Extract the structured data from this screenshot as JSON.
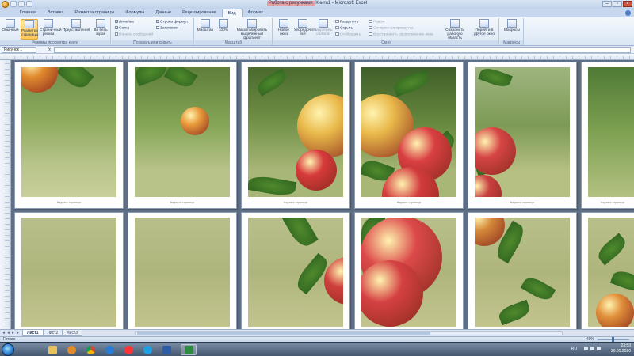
{
  "window": {
    "title_doc": "Книга1",
    "title_sep": " - ",
    "title_app": "Microsoft Excel",
    "title_extra": "Работа с рисунками"
  },
  "ribbon_tabs": [
    {
      "label": "Главная",
      "active": false
    },
    {
      "label": "Вставка",
      "active": false
    },
    {
      "label": "Разметка страницы",
      "active": false
    },
    {
      "label": "Формулы",
      "active": false
    },
    {
      "label": "Данные",
      "active": false
    },
    {
      "label": "Рецензирование",
      "active": false
    },
    {
      "label": "Вид",
      "active": true
    },
    {
      "label": "Формат",
      "active": false
    }
  ],
  "ribbon": {
    "group_views": {
      "label": "Режимы просмотра книги",
      "normal": "Обычный",
      "page_layout": "Разметка страницы",
      "page_mode": "Страничный режим",
      "custom_views": "Представления",
      "full_screen": "Во весь экран"
    },
    "group_show": {
      "label": "Показать или скрыть",
      "ruler": "Линейка",
      "grid": "Сетка",
      "messages": "Панель сообщений",
      "formula_bar": "Строка формул",
      "headings": "Заголовки"
    },
    "group_zoom": {
      "label": "Масштаб",
      "zoom": "Масштаб",
      "zoom100": "100%",
      "zoom_selection": "Масштабировать выделенный фрагмент"
    },
    "group_window": {
      "label": "Окно",
      "new_window": "Новое окно",
      "arrange_all": "Упорядочить все",
      "freeze": "Закрепить области",
      "split": "Разделить",
      "hide": "Скрыть",
      "unhide": "Отобразить",
      "side_by_side": "Рядом",
      "sync_scroll": "Синхронная прокрутка",
      "reset_pos": "Восстановить расположение окна",
      "save_workspace": "Сохранить рабочую область",
      "switch_windows": "Перейти в другое окно"
    },
    "group_macros": {
      "label": "Макросы",
      "macros": "Макросы"
    }
  },
  "formula_bar": {
    "name_box": "Рисунок 1",
    "fx": "fx",
    "formula": ""
  },
  "pages": {
    "label": "Надпись страницы"
  },
  "sheet_tabs": [
    {
      "label": "Лист1",
      "active": true
    },
    {
      "label": "Лист2",
      "active": false
    },
    {
      "label": "Лист3",
      "active": false
    }
  ],
  "status": {
    "ready": "Готово",
    "zoom": "40%"
  },
  "taskbar": {
    "lang": "RU",
    "time": "23:53",
    "date": "26.05.2020"
  },
  "colors": {
    "page_break": "#3c63c9",
    "sheet_bg": "#5e6f86",
    "active_ribbon_button": "#ffc95a"
  }
}
